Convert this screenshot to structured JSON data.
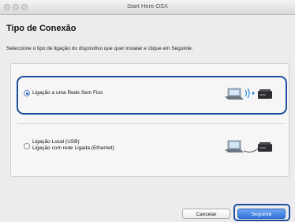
{
  "window": {
    "title": "Start Here OSX"
  },
  "header": {
    "title": "Tipo de Conexão"
  },
  "instruction": "Seleccione o tipo de ligação do dispositivo que quer instalar e clique em Seguinte.",
  "options": [
    {
      "label_line1": "Ligação a uma Rede Sem Fios",
      "label_line2": "",
      "selected": true,
      "icon": "wireless-connection-illustration"
    },
    {
      "label_line1": "Ligação Local (USB)",
      "label_line2": "Ligação com rede Ligada (Ethernet)",
      "selected": false,
      "icon": "wired-connection-illustration"
    }
  ],
  "buttons": {
    "cancel": "Cancelar",
    "next": "Seguinte"
  },
  "colors": {
    "highlight": "#1d4f9c",
    "primary_button": "#2f73df"
  }
}
